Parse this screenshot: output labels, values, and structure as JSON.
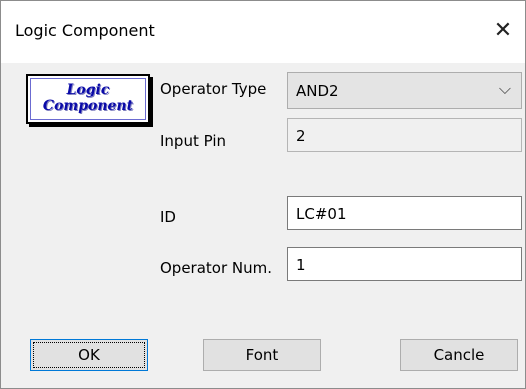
{
  "window": {
    "title": "Logic Component",
    "close_glyph": "✕"
  },
  "logo": {
    "line1": "Logic",
    "line2": "Component"
  },
  "form": {
    "operator_type": {
      "label": "Operator Type",
      "value": "AND2"
    },
    "input_pin": {
      "label": "Input Pin",
      "value": "2"
    },
    "id": {
      "label": "ID",
      "value": "LC#01"
    },
    "operator_num": {
      "label": "Operator Num.",
      "value": "1"
    }
  },
  "buttons": {
    "ok": "OK",
    "font": "Font",
    "cancel": "Cancle"
  },
  "icons": {
    "dropdown": "chevron-down-icon",
    "close": "close-icon"
  },
  "colors": {
    "focus_border": "#0078d7",
    "logo_text": "#0a0aa8"
  }
}
